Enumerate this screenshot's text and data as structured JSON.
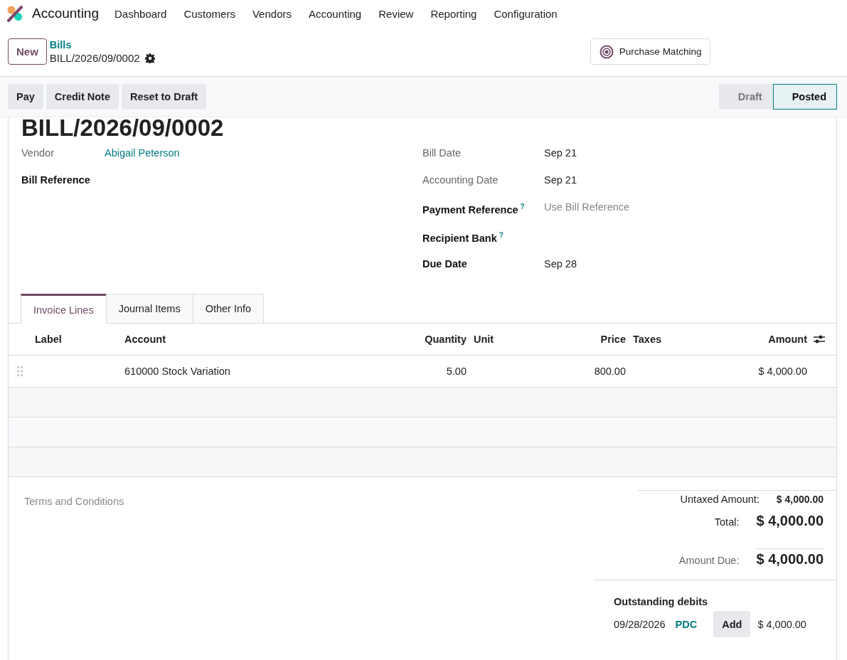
{
  "app": {
    "name": "Accounting"
  },
  "menu": [
    "Dashboard",
    "Customers",
    "Vendors",
    "Accounting",
    "Review",
    "Reporting",
    "Configuration"
  ],
  "new_button": "New",
  "breadcrumb": {
    "parent": "Bills",
    "current": "BILL/2026/09/0002"
  },
  "smart_button": "Purchase Matching",
  "actions": [
    "Pay",
    "Credit Note",
    "Reset to Draft"
  ],
  "statusbar": [
    {
      "label": "Draft",
      "selected": false
    },
    {
      "label": "Posted",
      "selected": true
    }
  ],
  "title": "BILL/2026/09/0002",
  "fields_left": [
    {
      "label": "Vendor",
      "kind": "readonly",
      "value": "Abigail Peterson",
      "link": true
    },
    {
      "label": "Bill Reference",
      "kind": "editable"
    }
  ],
  "fields_right": [
    {
      "label": "Bill Date",
      "kind": "readonly",
      "value": "Sep 21"
    },
    {
      "label": "Accounting Date",
      "kind": "readonly",
      "value": "Sep 21"
    },
    {
      "label": "Payment Reference",
      "kind": "editable",
      "help": "?",
      "placeholder": "Use Bill Reference"
    },
    {
      "label": "Recipient Bank",
      "kind": "editable",
      "help": "?"
    },
    {
      "label": "Due Date",
      "kind": "editable",
      "value": "Sep 28"
    }
  ],
  "tabs": [
    {
      "label": "Invoice Lines",
      "selected": true
    },
    {
      "label": "Journal Items",
      "selected": false
    },
    {
      "label": "Other Info",
      "selected": false
    }
  ],
  "table": {
    "columns": [
      "Label",
      "Account",
      "Quantity",
      "Unit",
      "Price",
      "Taxes",
      "Amount"
    ],
    "rows": [
      {
        "account": "610000 Stock Variation",
        "quantity": "5.00",
        "price": "800.00",
        "amount": "$ 4,000.00"
      }
    ]
  },
  "terms": {
    "placeholder": "Terms and Conditions"
  },
  "totals": [
    {
      "label": "Untaxed Amount:",
      "value": "$ 4,000.00",
      "kind": "subtotal"
    },
    {
      "label": "Total:",
      "value": "$ 4,000.00",
      "kind": "total"
    },
    {
      "label": "Amount Due:",
      "value": "$ 4,000.00",
      "kind": "due"
    }
  ],
  "outstanding": {
    "title": "Outstanding debits",
    "items": [
      {
        "date": "09/28/2026",
        "ref": "PDC",
        "button": "Add",
        "amount": "$ 4,000.00"
      }
    ]
  }
}
